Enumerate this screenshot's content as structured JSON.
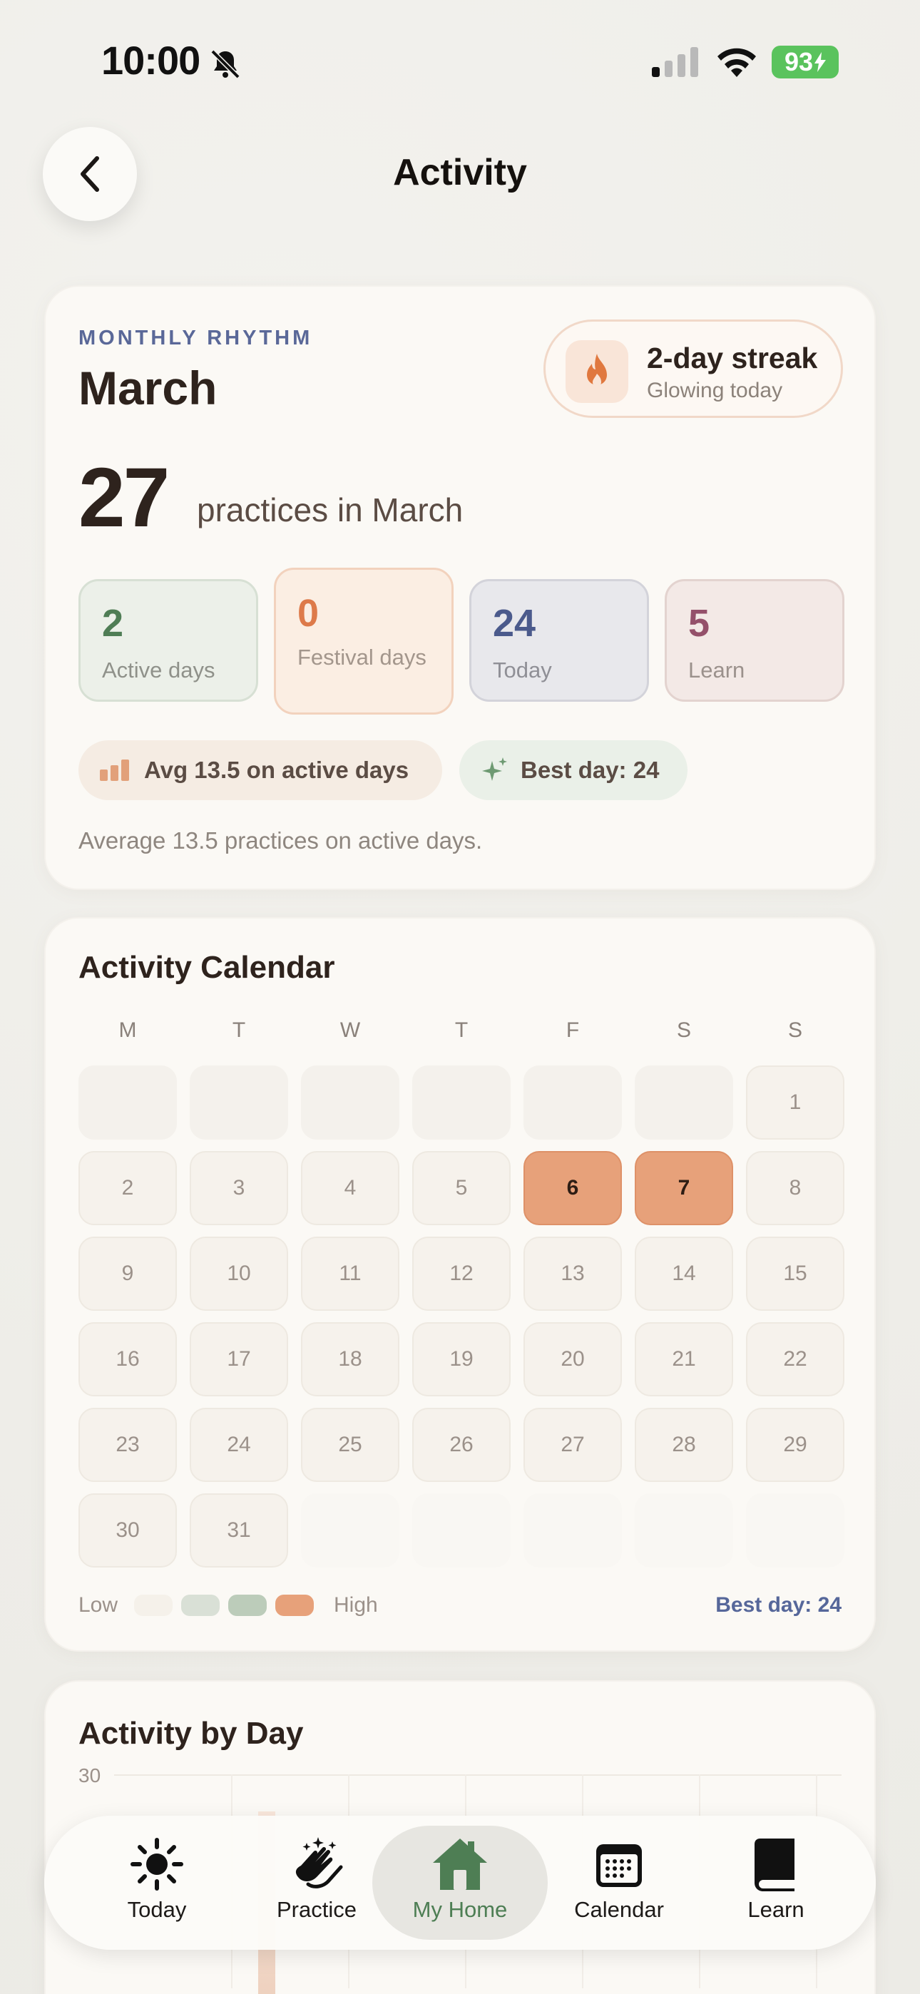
{
  "status_bar": {
    "time": "10:00",
    "battery": "93"
  },
  "header": {
    "title": "Activity"
  },
  "rhythm": {
    "eyebrow": "MONTHLY RHYTHM",
    "month": "March",
    "streak_title": "2-day streak",
    "streak_sub": "Glowing today",
    "count": "27",
    "count_label": "practices in March",
    "stats": [
      {
        "value": "2",
        "label": "Active days"
      },
      {
        "value": "0",
        "label": "Festival days"
      },
      {
        "value": "24",
        "label": "Today"
      },
      {
        "value": "5",
        "label": "Learn"
      }
    ],
    "avg_chip": "Avg 13.5 on active days",
    "best_chip": "Best day: 24",
    "note": "Average 13.5 practices on active days."
  },
  "calendar": {
    "title": "Activity Calendar",
    "weekdays": [
      "M",
      "T",
      "W",
      "T",
      "F",
      "S",
      "S"
    ],
    "first_weekday_index": 6,
    "days_in_month": 31,
    "high_days": [
      6,
      7
    ],
    "legend_low": "Low",
    "legend_high": "High",
    "best_day": "Best day: 24",
    "legend_colors": [
      "#f5f1ea",
      "#d9e0d6",
      "#bcccba",
      "#e7a17a"
    ]
  },
  "by_day": {
    "title": "Activity by Day",
    "y_max": "30"
  },
  "tabs": [
    {
      "label": "Today",
      "icon": "sun-icon"
    },
    {
      "label": "Practice",
      "icon": "clapping-hands-icon"
    },
    {
      "label": "My Home",
      "icon": "home-icon",
      "active": true
    },
    {
      "label": "Calendar",
      "icon": "calendar-icon"
    },
    {
      "label": "Learn",
      "icon": "book-icon"
    }
  ]
}
